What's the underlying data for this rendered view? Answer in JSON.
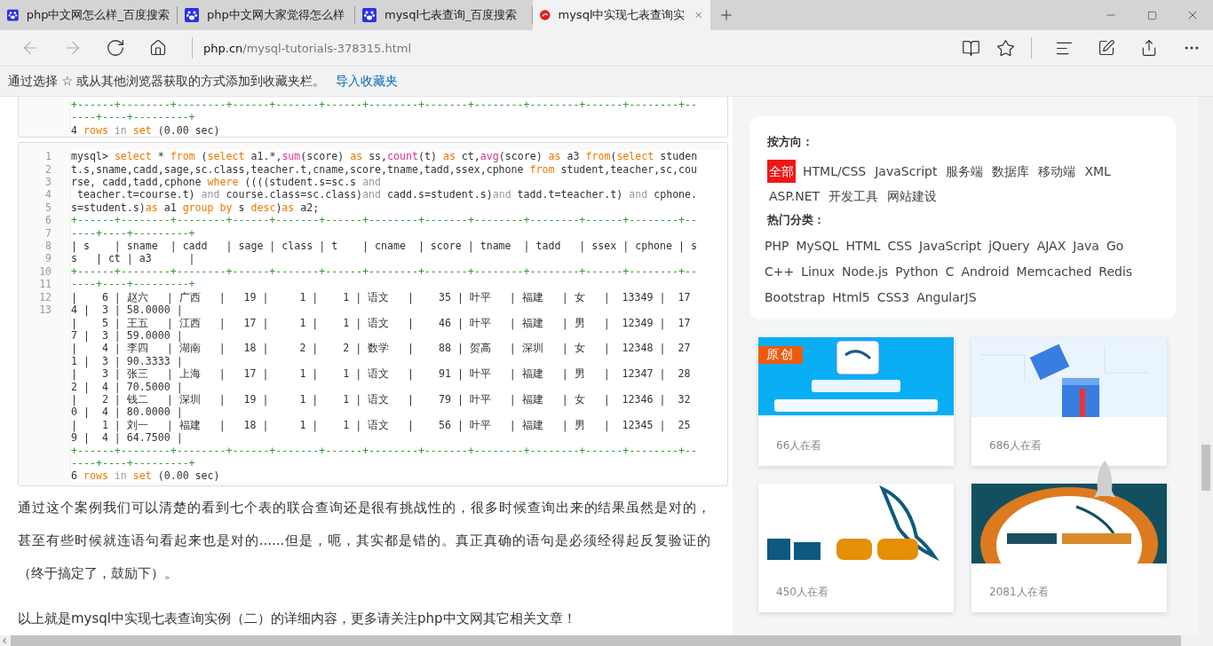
{
  "browser": {
    "tabs": [
      {
        "kind": "paw",
        "title": "php中文网怎么样_百度搜索",
        "selected": false
      },
      {
        "kind": "paw",
        "title": "php中文网大家觉得怎么样",
        "selected": false
      },
      {
        "kind": "paw",
        "title": "mysql七表查询_百度搜索",
        "selected": false
      },
      {
        "kind": "php",
        "title": "mysql中实现七表查询实",
        "selected": true
      }
    ],
    "address": {
      "host": "php.cn",
      "path": "/mysql-tutorials-378315.html"
    }
  },
  "favorites_bar": {
    "message": "通过选择 ☆ 或从其他浏览器获取的方式添加到收藏夹栏。",
    "link": "导入收藏夹"
  },
  "code_blocks": [
    {
      "lines": [
        [
          {
            "kind": "border",
            "text": "+------+--------+--------+------+-------+------+--------+-------+--------+--------+------+--------+--"
          }
        ],
        [
          {
            "kind": "border",
            "text": "----+----+---------+"
          }
        ],
        [
          {
            "kind": "plain",
            "text": "4 "
          },
          {
            "kind": "keyword",
            "text": "rows"
          },
          {
            "kind": "operator",
            "text": " in "
          },
          {
            "kind": "keyword",
            "text": "set"
          },
          {
            "kind": "plain",
            "text": " (0.00 sec)"
          }
        ]
      ]
    },
    {
      "line_numbers": [
        "1",
        "2",
        "3",
        "4",
        "5",
        "6",
        "7",
        "8",
        "9",
        "10",
        "11",
        "12",
        "13"
      ],
      "lines": [
        [
          {
            "kind": "plain",
            "text": "mysql> "
          },
          {
            "kind": "keyword",
            "text": "select"
          },
          {
            "kind": "plain",
            "text": " * "
          },
          {
            "kind": "keyword",
            "text": "from"
          },
          {
            "kind": "plain",
            "text": " ("
          },
          {
            "kind": "keyword",
            "text": "select"
          },
          {
            "kind": "plain",
            "text": " a1.*,"
          },
          {
            "kind": "function",
            "text": "sum"
          },
          {
            "kind": "plain",
            "text": "(score) "
          },
          {
            "kind": "keyword",
            "text": "as"
          },
          {
            "kind": "plain",
            "text": " ss,"
          },
          {
            "kind": "function",
            "text": "count"
          },
          {
            "kind": "plain",
            "text": "(t) "
          },
          {
            "kind": "keyword",
            "text": "as"
          },
          {
            "kind": "plain",
            "text": " ct,"
          },
          {
            "kind": "function",
            "text": "avg"
          },
          {
            "kind": "plain",
            "text": "(score) "
          },
          {
            "kind": "keyword",
            "text": "as"
          },
          {
            "kind": "plain",
            "text": " a3 "
          },
          {
            "kind": "keyword",
            "text": "from"
          },
          {
            "kind": "plain",
            "text": "("
          },
          {
            "kind": "keyword",
            "text": "select"
          },
          {
            "kind": "plain",
            "text": " studen"
          }
        ],
        [
          {
            "kind": "plain",
            "text": "t.s,sname,cadd,sage,sc.class,teacher.t,cname,score,tname,tadd,ssex,cphone "
          },
          {
            "kind": "keyword",
            "text": "from"
          },
          {
            "kind": "plain",
            "text": " student,teacher,sc,cou"
          }
        ],
        [
          {
            "kind": "plain",
            "text": "rse, cadd,tadd,cphone "
          },
          {
            "kind": "keyword",
            "text": "where"
          },
          {
            "kind": "plain",
            "text": " ((((student.s=sc.s "
          },
          {
            "kind": "operator",
            "text": "and"
          }
        ],
        [
          {
            "kind": "plain",
            "text": " teacher.t=course.t) "
          },
          {
            "kind": "operator",
            "text": "and"
          },
          {
            "kind": "plain",
            "text": " course.class=sc.class)"
          },
          {
            "kind": "operator",
            "text": "and"
          },
          {
            "kind": "plain",
            "text": " cadd.s=student.s)"
          },
          {
            "kind": "operator",
            "text": "and"
          },
          {
            "kind": "plain",
            "text": " tadd.t=teacher.t) "
          },
          {
            "kind": "operator",
            "text": "and"
          },
          {
            "kind": "plain",
            "text": " cphone."
          }
        ],
        [
          {
            "kind": "plain",
            "text": "s=student.s)"
          },
          {
            "kind": "keyword",
            "text": "as"
          },
          {
            "kind": "plain",
            "text": " a1 "
          },
          {
            "kind": "keyword",
            "text": "group by"
          },
          {
            "kind": "plain",
            "text": " s "
          },
          {
            "kind": "keyword",
            "text": "desc"
          },
          {
            "kind": "plain",
            "text": ")"
          },
          {
            "kind": "keyword",
            "text": "as"
          },
          {
            "kind": "plain",
            "text": " a2;"
          }
        ],
        [
          {
            "kind": "border",
            "text": "+------+--------+--------+------+-------+------+--------+-------+--------+--------+------+--------+--"
          }
        ],
        [
          {
            "kind": "border",
            "text": "----+----+---------+"
          }
        ],
        [
          {
            "kind": "plain",
            "text": "| s    | sname  | cadd   | sage | class | t    | cname  | score | tname  | tadd   | ssex | cphone | s"
          }
        ],
        [
          {
            "kind": "plain",
            "text": "s   | ct | a3      |"
          }
        ],
        [
          {
            "kind": "border",
            "text": "+------+--------+--------+------+-------+------+--------+-------+--------+--------+------+--------+--"
          }
        ],
        [
          {
            "kind": "border",
            "text": "----+----+---------+"
          }
        ],
        [
          {
            "kind": "plain",
            "text": "|    6 | 赵六   | 广西   |   19 |     1 |    1 | 语文   |    35 | 叶平   | 福建   | 女   |  13349 |  17"
          }
        ],
        [
          {
            "kind": "plain",
            "text": "4 |  3 | 58.0000 |"
          }
        ],
        [
          {
            "kind": "plain",
            "text": "|    5 | 王五   | 江西   |   17 |     1 |    1 | 语文   |    46 | 叶平   | 福建   | 男   |  12349 |  17"
          }
        ],
        [
          {
            "kind": "plain",
            "text": "7 |  3 | 59.0000 |"
          }
        ],
        [
          {
            "kind": "plain",
            "text": "|    4 | 李四   | 湖南   |   18 |     2 |    2 | 数学   |    88 | 贺高   | 深圳   | 女   |  12348 |  27"
          }
        ],
        [
          {
            "kind": "plain",
            "text": "1 |  3 | 90.3333 |"
          }
        ],
        [
          {
            "kind": "plain",
            "text": "|    3 | 张三   | 上海   |   17 |     1 |    1 | 语文   |    91 | 叶平   | 福建   | 男   |  12347 |  28"
          }
        ],
        [
          {
            "kind": "plain",
            "text": "2 |  4 | 70.5000 |"
          }
        ],
        [
          {
            "kind": "plain",
            "text": "|    2 | 钱二   | 深圳   |   19 |     1 |    1 | 语文   |    79 | 叶平   | 福建   | 女   |  12346 |  32"
          }
        ],
        [
          {
            "kind": "plain",
            "text": "0 |  4 | 80.0000 |"
          }
        ],
        [
          {
            "kind": "plain",
            "text": "|    1 | 刘一   | 福建   |   18 |     1 |    1 | 语文   |    56 | 叶平   | 福建   | 男   |  12345 |  25"
          }
        ],
        [
          {
            "kind": "plain",
            "text": "9 |  4 | 64.7500 |"
          }
        ],
        [
          {
            "kind": "border",
            "text": "+------+--------+--------+------+-------+------+--------+-------+--------+--------+------+--------+--"
          }
        ],
        [
          {
            "kind": "border",
            "text": "----+----+---------+"
          }
        ],
        [
          {
            "kind": "plain",
            "text": "6 "
          },
          {
            "kind": "keyword",
            "text": "rows"
          },
          {
            "kind": "operator",
            "text": " in "
          },
          {
            "kind": "keyword",
            "text": "set"
          },
          {
            "kind": "plain",
            "text": " (0.00 sec)"
          }
        ]
      ]
    }
  ],
  "paragraphs": [
    [
      "通过这个案例我们可以清楚的看到七个表的联合查询还是很有挑战性的，很多时候查询出来的结果虽然是对的，",
      "甚至有些时候就连语句看起来也是对的......但是，呃，其实都是错的。真正真确的语句是必须经得起反复验证的",
      "（终于搞定了，鼓励下）。"
    ],
    [
      "以上就是mysql中实现七表查询实例（二）的详细内容，更多请关注php中文网其它相关文章！"
    ]
  ],
  "sidebar": {
    "direction": {
      "title": "按方向：",
      "items": [
        {
          "label": "全部",
          "selected": true
        },
        {
          "label": "HTML/CSS",
          "selected": false
        },
        {
          "label": "JavaScript",
          "selected": false
        },
        {
          "label": "服务端",
          "selected": false
        },
        {
          "label": "数据库",
          "selected": false
        },
        {
          "label": "移动端",
          "selected": false
        },
        {
          "label": "XML",
          "selected": false
        },
        {
          "label": "ASP.NET",
          "selected": false
        },
        {
          "label": "开发工具",
          "selected": false
        },
        {
          "label": "网站建设",
          "selected": false
        }
      ]
    },
    "hot": {
      "title": "热门分类：",
      "items": [
        "PHP",
        "MySQL",
        "HTML",
        "CSS",
        "JavaScript",
        "jQuery",
        "AJAX",
        "Java",
        "Go",
        "C++",
        "Linux",
        "Node.js",
        "Python",
        "C",
        "Android",
        "Memcached",
        "Redis",
        "Bootstrap",
        "Html5",
        "CSS3",
        "AngularJS"
      ]
    },
    "courses": [
      {
        "kind": "picture",
        "badge": "原创",
        "viewers": "66人在看"
      },
      {
        "kind": "picture",
        "viewers": "686人在看"
      },
      {
        "kind": "picture",
        "viewers": "450人在看"
      },
      {
        "kind": "picture",
        "viewers": "2081人在看"
      }
    ]
  }
}
